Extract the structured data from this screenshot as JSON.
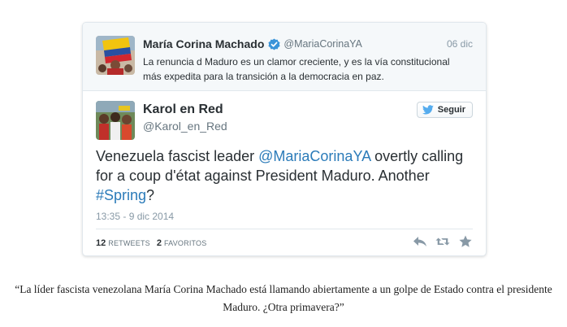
{
  "parent_tweet": {
    "name": "María Corina Machado",
    "handle": "@MariaCorinaYA",
    "date": "06 dic",
    "text": "La renuncia d Maduro es un clamor creciente, y es la vía constitucional más expedita para la transición a la democracia en paz."
  },
  "tweet": {
    "name": "Karol en Red",
    "handle": "@Karol_en_Red",
    "follow_label": "Seguir",
    "text_part1": "Venezuela fascist leader ",
    "mention": "@MariaCorinaYA",
    "text_part2": " overtly calling for a coup d'état against President Maduro.  Another ",
    "hashtag": "#Spring",
    "text_part3": "?",
    "timestamp": "13:35 - 9 dic 2014",
    "retweets_count": "12",
    "retweets_label": "RETWEETS",
    "favorites_count": "2",
    "favorites_label": "FAVORITOS"
  },
  "caption": "“La líder fascista venezolana María Corina Machado está llamando abiertamente a un golpe de Estado contra el presidente Maduro. ¿Otra primavera?”",
  "colors": {
    "link": "#2b7bb9",
    "verified": "#3b94d9",
    "twitter_blue": "#55acee",
    "muted": "#8899a6"
  },
  "icons": [
    "verified-badge-icon",
    "twitter-bird-icon",
    "reply-icon",
    "retweet-icon",
    "favorite-star-icon"
  ]
}
